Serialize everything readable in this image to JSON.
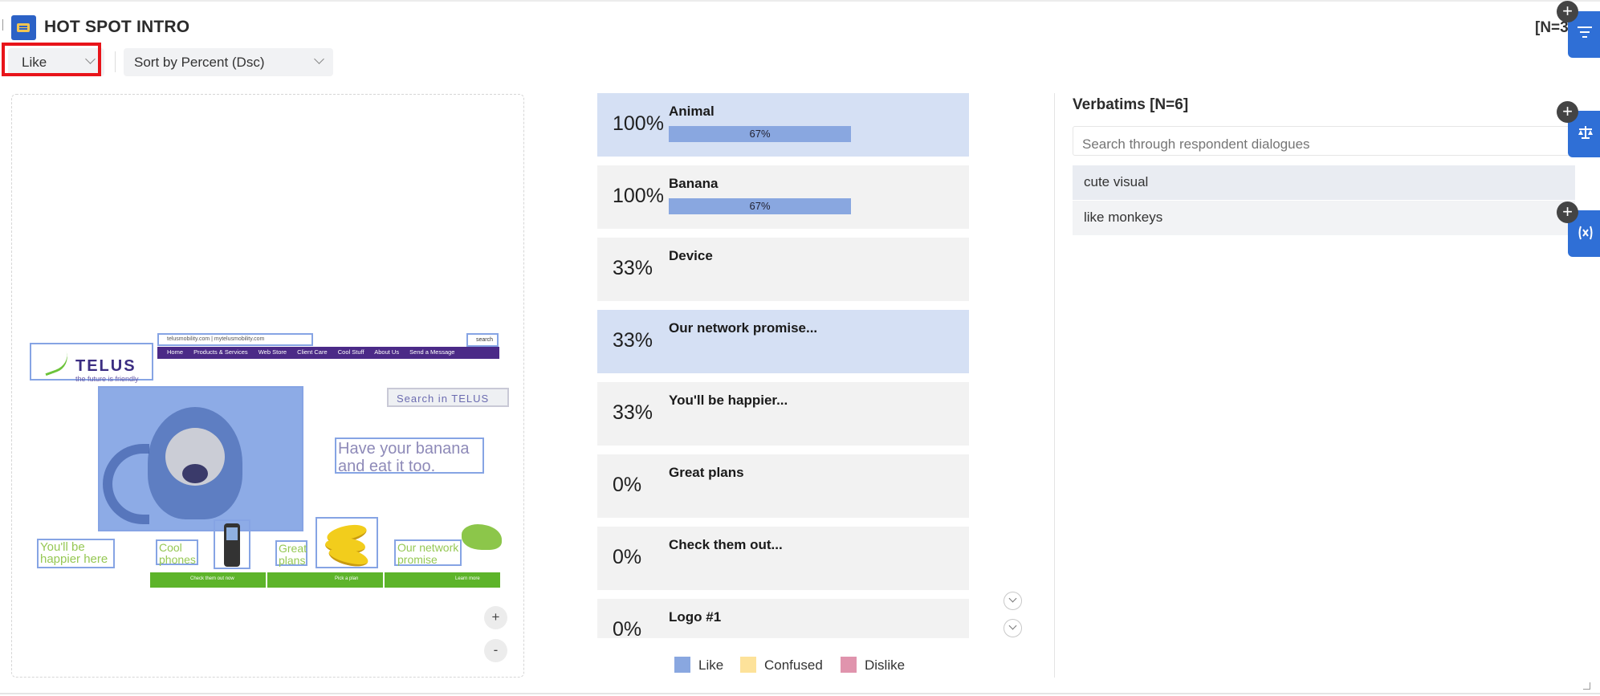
{
  "header": {
    "title": "HOT SPOT INTRO",
    "n_label": "[N=3]"
  },
  "filters": {
    "reaction_selected": "Like",
    "sort_selected": "Sort by Percent (Dsc)"
  },
  "stimulus": {
    "logo_text": "TELUS",
    "logo_tagline": "the future is friendly",
    "url_text": "telusmobility.com  |  mytelusmobility.com",
    "search_button": "search",
    "nav_items": [
      "Home",
      "Products & Services",
      "Web Store",
      "Client Care",
      "Cool Stuff",
      "About Us",
      "Send a Message"
    ],
    "placeholder_text": "Search in TELUS",
    "headline": "Have your banana and eat it too.",
    "tiles": [
      "You'll be happier here",
      "Cool phones",
      "Great plans",
      "Our network promise"
    ],
    "green_buttons": [
      "Check them out now",
      "Pick a plan",
      "Learn more"
    ]
  },
  "zoom": {
    "in": "+",
    "out": "-"
  },
  "hotspots": [
    {
      "pct": "100%",
      "label": "Animal",
      "bar_value": 67,
      "bar_text": "67%",
      "selected": true
    },
    {
      "pct": "100%",
      "label": "Banana",
      "bar_value": 67,
      "bar_text": "67%",
      "selected": false
    },
    {
      "pct": "33%",
      "label": "Device",
      "selected": false
    },
    {
      "pct": "33%",
      "label": "Our network promise...",
      "selected": true
    },
    {
      "pct": "33%",
      "label": "You'll be happier...",
      "selected": false
    },
    {
      "pct": "0%",
      "label": "Great plans",
      "selected": false
    },
    {
      "pct": "0%",
      "label": "Check them out...",
      "selected": false
    },
    {
      "pct": "0%",
      "label": "Logo #1",
      "selected": false
    }
  ],
  "legend": [
    {
      "label": "Like",
      "color": "#89a7e0"
    },
    {
      "label": "Confused",
      "color": "#fde29a"
    },
    {
      "label": "Dislike",
      "color": "#e094ad"
    }
  ],
  "verbatims": {
    "title": "Verbatims [N=6]",
    "search_placeholder": "Search through respondent dialogues",
    "items": [
      "cute visual",
      "like monkeys"
    ]
  },
  "side_tabs": [
    {
      "icon": "filter-icon"
    },
    {
      "icon": "balance-scale-icon"
    },
    {
      "icon": "variable-x-icon"
    }
  ],
  "colors": {
    "accent": "#2f6fd6",
    "highlight_box": "#e8141a",
    "selected_row": "#d5e0f4",
    "row_bg": "#f2f2f2"
  }
}
